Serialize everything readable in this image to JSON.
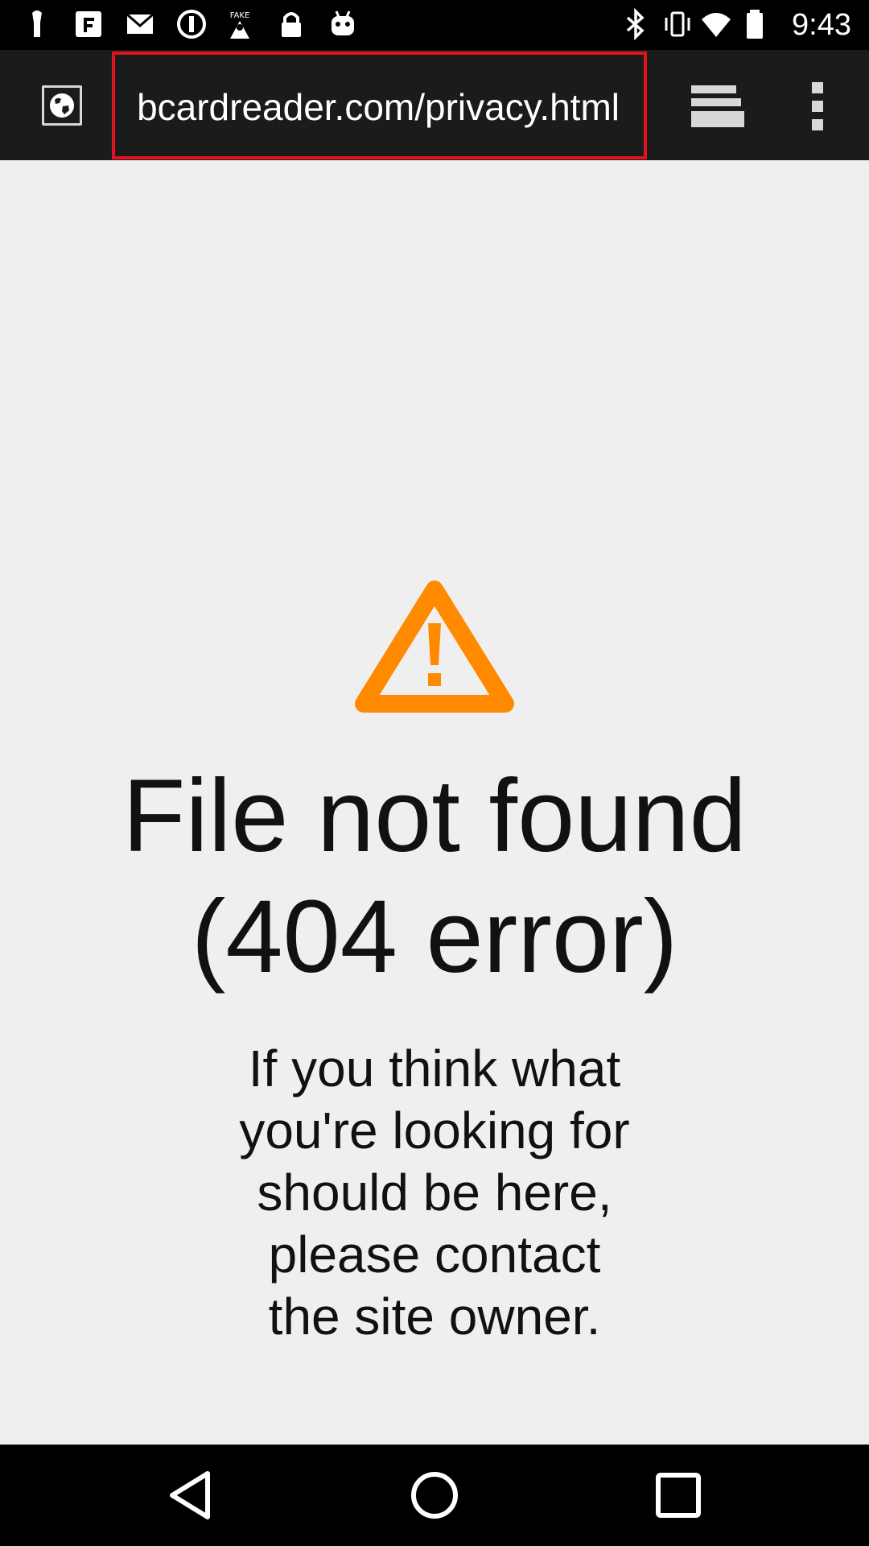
{
  "status_bar": {
    "time": "9:43",
    "icons": [
      "usb-icon",
      "app-notification-icon",
      "mail-icon",
      "info-circle-icon",
      "fake-gps-icon",
      "lock-icon",
      "android-icon",
      "bluetooth-icon"
    ]
  },
  "toolbar": {
    "url": "bcardreader.com/privacy.html",
    "icons": [
      "globe-icon",
      "tabs-icon",
      "overflow-menu-icon"
    ]
  },
  "page": {
    "title_line1": "File not found",
    "title_line2": "(404 error)",
    "message_lines": [
      "If you think what",
      "you're looking for",
      "should be here,",
      "please contact",
      "the site owner."
    ]
  },
  "colors": {
    "warning": "#ff8a00",
    "highlight_box": "#e0141e",
    "toolbar_bg": "#1b1b1b",
    "content_bg": "#efefef"
  },
  "nav_bar": {
    "icons": [
      "back-icon",
      "home-icon",
      "recents-icon"
    ]
  }
}
